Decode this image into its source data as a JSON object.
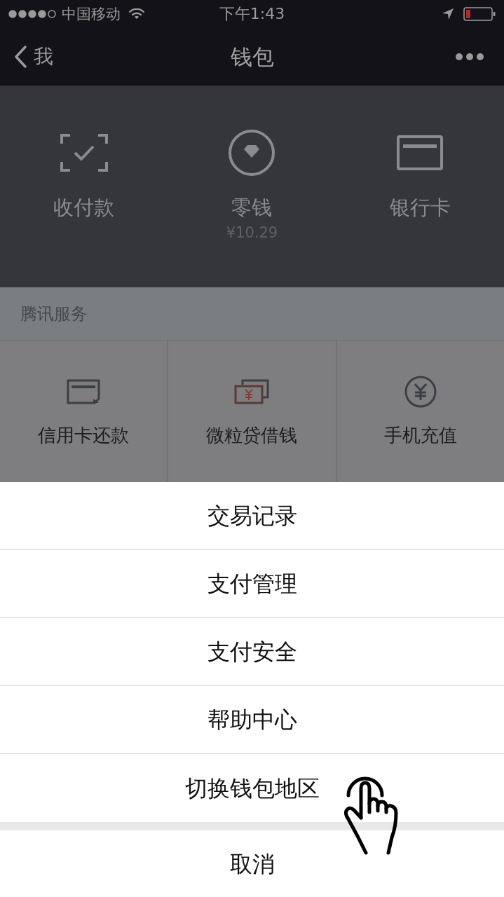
{
  "status_bar": {
    "carrier": "中国移动",
    "time": "下午1:43"
  },
  "nav_bar": {
    "back_label": "我",
    "title": "钱包"
  },
  "wallet_items": [
    {
      "label": "收付款"
    },
    {
      "label": "零钱",
      "amount": "¥10.29"
    },
    {
      "label": "银行卡"
    }
  ],
  "services": {
    "title": "腾讯服务",
    "items": [
      {
        "label": "信用卡还款"
      },
      {
        "label": "微粒贷借钱"
      },
      {
        "label": "手机充值"
      }
    ]
  },
  "action_sheet": {
    "items": [
      "交易记录",
      "支付管理",
      "支付安全",
      "帮助中心",
      "切换钱包地区"
    ],
    "cancel": "取消"
  }
}
